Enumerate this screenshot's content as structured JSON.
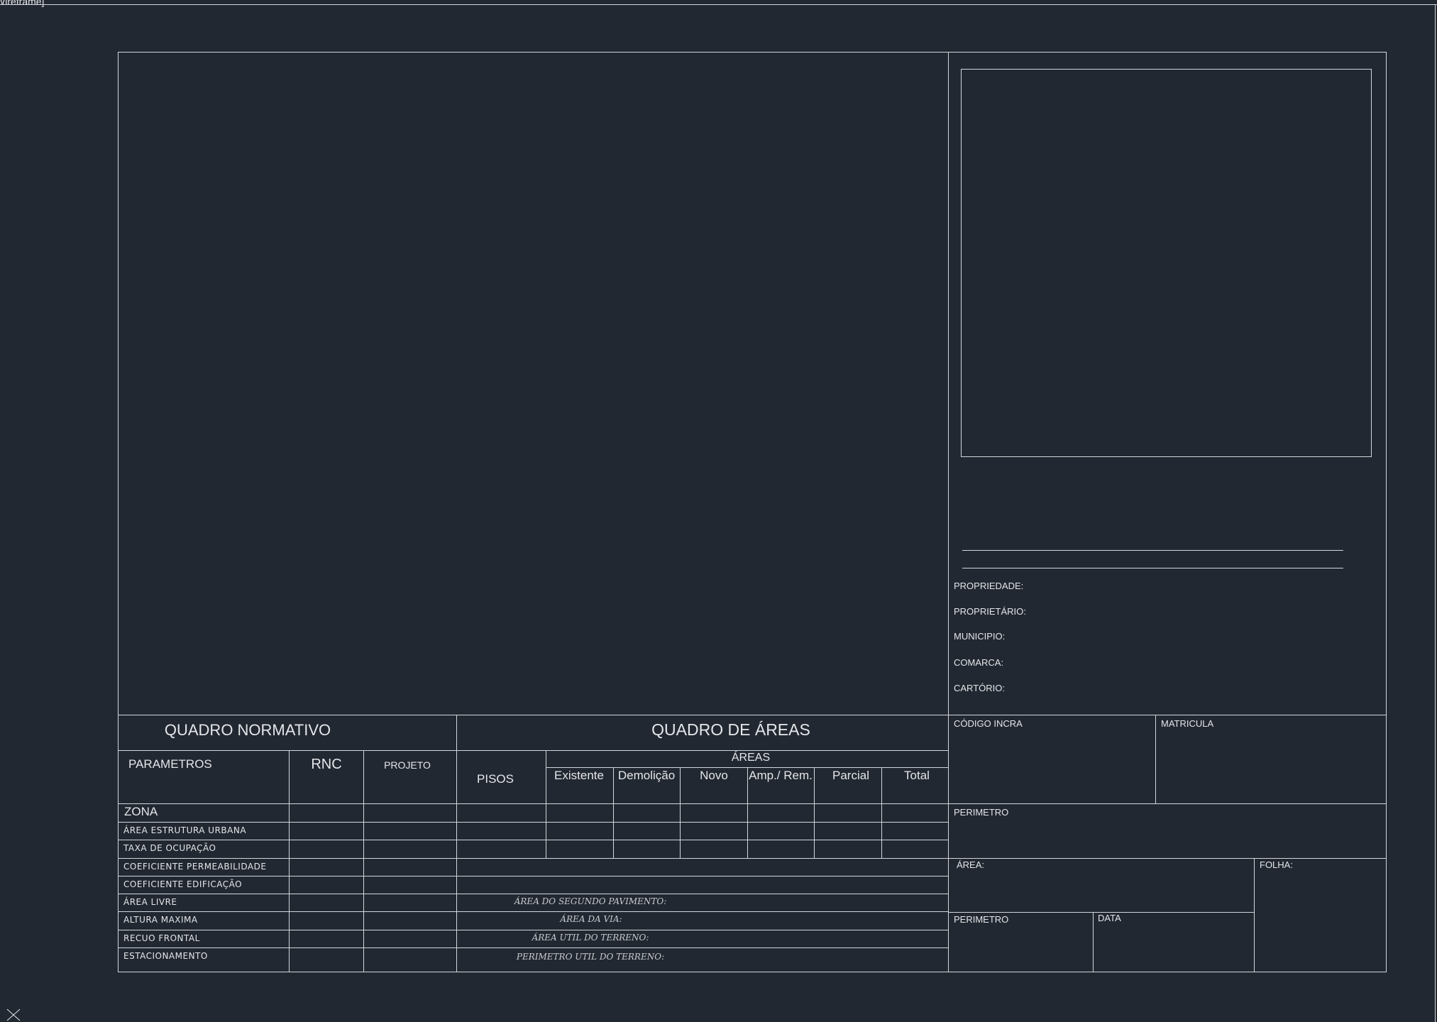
{
  "viewport": {
    "label": "Wireframe]"
  },
  "quadro_normativo": {
    "title": "QUADRO NORMATIVO",
    "headers": {
      "parametros": "PARAMETROS",
      "rnc": "RNC",
      "projeto": "PROJETO"
    },
    "rows": [
      "ZONA",
      "ÁREA ESTRUTURA URBANA",
      "TAXA DE OCUPAÇÃO",
      "COEFICIENTE PERMEABILIDADE",
      "COEFICIENTE EDIFICAÇÃO",
      "ÁREA LIVRE",
      "ALTURA MAXIMA",
      "RECUO FRONTAL",
      "ESTACIONAMENTO"
    ]
  },
  "quadro_areas": {
    "title": "QUADRO DE ÁREAS",
    "pisos": "PISOS",
    "areas": "ÁREAS",
    "columns": [
      "Existente",
      "Demolição",
      "Novo",
      "Amp./ Rem.",
      "Parcial",
      "Total"
    ],
    "notes": [
      "ÁREA DO SEGUNDO PAVIMENTO:",
      "ÁREA DA VIA:",
      "ÁREA UTIL DO TERRENO:",
      "PERIMETRO UTIL DO TERRENO:"
    ]
  },
  "info": {
    "propriedade": "PROPRIEDADE:",
    "proprietario": "PROPRIETÁRIO:",
    "municipio": "MUNICIPIO:",
    "comarca": "COMARCA:",
    "cartorio": "CARTÓRIO:"
  },
  "title_block": {
    "codigo_incra": "CÓDIGO INCRA",
    "matricula": "MATRICULA",
    "perimetro_1": "PERIMETRO",
    "area": "ÁREA:",
    "folha": "FOLHA:",
    "perimetro_2": "PERIMETRO",
    "data": "DATA"
  },
  "colors": {
    "background": "#222831",
    "linework": "#d4d7dc"
  },
  "icons": {
    "ucs": "ucs-icon"
  }
}
